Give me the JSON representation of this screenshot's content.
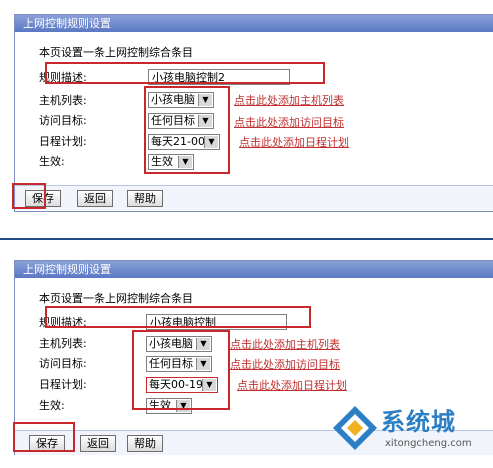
{
  "panel1": {
    "title": "上网控制规则设置",
    "intro": "本页设置一条上网控制综合条目",
    "labels": {
      "desc": "规则描述:",
      "host": "主机列表:",
      "target": "访问目标:",
      "schedule": "日程计划:",
      "effect": "生效:"
    },
    "desc_value": "小孩电脑控制2",
    "host_value": "小孩电脑",
    "target_value": "任何目标",
    "schedule_value": "每天21-00",
    "effect_value": "生效",
    "links": {
      "host": "点击此处添加主机列表",
      "target": "点击此处添加访问目标",
      "schedule": "点击此处添加日程计划"
    },
    "buttons": {
      "save": "保存",
      "back": "返回",
      "help": "帮助"
    }
  },
  "panel2": {
    "title": "上网控制规则设置",
    "intro": "本页设置一条上网控制综合条目",
    "labels": {
      "desc": "规则描述:",
      "host": "主机列表:",
      "target": "访问目标:",
      "schedule": "日程计划:",
      "effect": "生效:"
    },
    "desc_value": "小孩电脑控制",
    "host_value": "小孩电脑",
    "target_value": "任何目标",
    "schedule_value": "每天00-19",
    "effect_value": "生效",
    "links": {
      "host": "点击此处添加主机列表",
      "target": "点击此处添加访问目标",
      "schedule": "点击此处添加日程计划"
    },
    "buttons": {
      "save": "保存",
      "back": "返回",
      "help": "帮助"
    }
  },
  "watermark": {
    "title": "系统城",
    "url": "xitongcheng.com"
  },
  "colors": {
    "title_bar": "#5a78c4",
    "highlight": "#c8282c",
    "link": "#c03030",
    "divider": "#1f4c86"
  }
}
